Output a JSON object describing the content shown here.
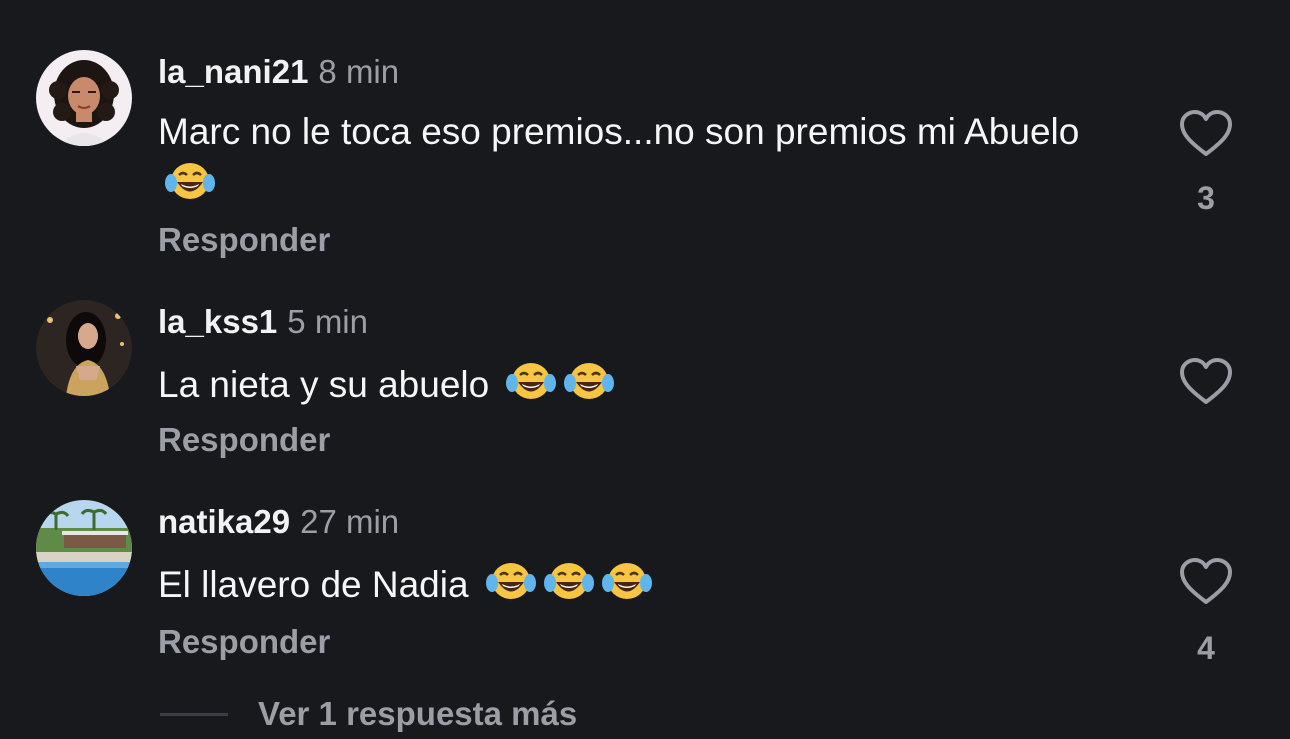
{
  "comments": [
    {
      "username": "la_nani21",
      "time": "8 min",
      "text": "Marc no le toca eso premios...no son premios mi Abuelo",
      "emojis": [
        "face-with-tears-of-joy"
      ],
      "reply_label": "Responder",
      "likes": "3",
      "avatar": "cartoon-avatar-curly-hair"
    },
    {
      "username": "la_kss1",
      "time": "5 min",
      "text": "La nieta y su abuelo",
      "emojis": [
        "face-with-tears-of-joy",
        "face-with-tears-of-joy"
      ],
      "reply_label": "Responder",
      "likes": "",
      "avatar": "photo-woman-dark-hair"
    },
    {
      "username": "natika29",
      "time": "27 min",
      "text": "El llavero de Nadia",
      "emojis": [
        "face-with-tears-of-joy",
        "face-with-tears-of-joy",
        "face-with-tears-of-joy"
      ],
      "reply_label": "Responder",
      "likes": "4",
      "avatar": "photo-pool-palm-trees"
    }
  ],
  "view_more": {
    "label": "Ver 1 respuesta más"
  },
  "colors": {
    "background": "#17191c",
    "primary_text": "#f1f2f4",
    "secondary_text": "#9b9ea4",
    "heart_outline": "#9b9ea4"
  },
  "icons": {
    "like": "heart-outline-icon",
    "emoji": "face-with-tears-of-joy"
  }
}
